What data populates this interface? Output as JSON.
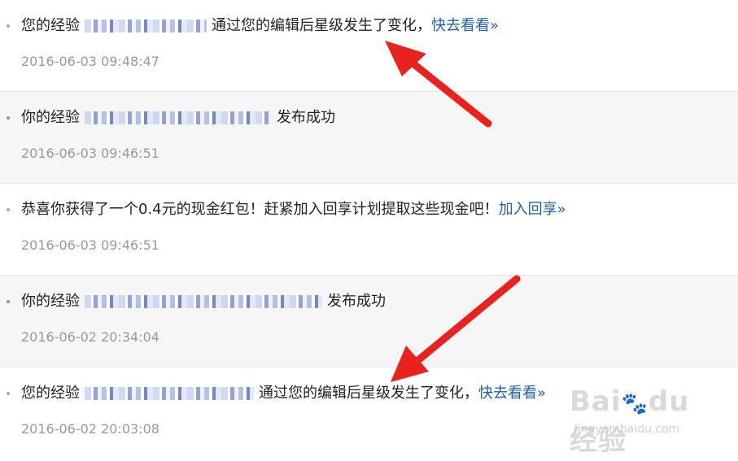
{
  "notifications": [
    {
      "prefix": "您的经验",
      "suffix": "通过您的编辑后星级发生了变化，",
      "link": "快去看看»",
      "time": "2016-06-03 09:48:47",
      "bullet": "gray",
      "blur_width": 150
    },
    {
      "prefix": "你的经验",
      "suffix": "发布成功",
      "link": "",
      "time": "2016-06-03 09:46:51",
      "bullet": "green",
      "blur_width": 230
    },
    {
      "prefix": "恭喜你获得了一个0.4元的现金红包！赶紧加入回享计划提取这些现金吧！",
      "suffix": "",
      "link": "加入回享»",
      "time": "2016-06-03 09:46:51",
      "bullet": "gray",
      "blur_width": 0
    },
    {
      "prefix": "你的经验",
      "suffix": "发布成功",
      "link": "",
      "time": "2016-06-02 20:34:04",
      "bullet": "green",
      "blur_width": 292
    },
    {
      "prefix": "您的经验",
      "suffix": "通过您的编辑后星级发生了变化，",
      "link": "快去看看»",
      "time": "2016-06-02 20:03:08",
      "bullet": "gray",
      "blur_width": 208
    }
  ],
  "watermark": {
    "brand": "Bai",
    "brand2": "du",
    "cn": "经验",
    "url": "jingyan.baidu.com"
  },
  "colors": {
    "link": "#2560a8",
    "arrow": "#e8231e",
    "bullet_green": "#5cb85c",
    "bullet_gray": "#aaaaaa"
  }
}
